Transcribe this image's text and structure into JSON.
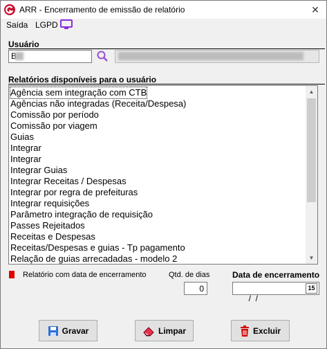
{
  "window": {
    "title": "ARR - Encerramento de emissão de relatório",
    "close_glyph": "✕"
  },
  "menu": {
    "items": [
      "Saída",
      "LGPD"
    ],
    "monitor_icon": "monitor-icon"
  },
  "user": {
    "label": "Usuário",
    "code_value": "B",
    "name_value": ""
  },
  "reports": {
    "label": "Relatórios disponíveis para o usuário",
    "items": [
      "Agência sem integração com CTB",
      "Agências não integradas (Receita/Despesa)",
      "Comissão por período",
      "Comissão por viagem",
      "Guias",
      "Integrar",
      "Integrar",
      "Integrar Guias",
      "Integrar Receitas / Despesas",
      "Integrar por regra de prefeituras",
      "Integrar requisições",
      "Parâmetro integração de requisição",
      "Passes Rejeitados",
      "Receitas e Despesas",
      "Receitas/Despesas e guias - Tp pagamento",
      "Relação de guias arrecadadas - modelo 2"
    ],
    "selected_index": 0,
    "scroll_up": "▲",
    "scroll_down": "▼"
  },
  "legend": {
    "text": "Relatório com data de encerramento",
    "color": "#e00000"
  },
  "qtd": {
    "label": "Qtd. de dias",
    "value": "0"
  },
  "date": {
    "label": "Data de encerramento",
    "value": " /  /",
    "calendar_label": "15"
  },
  "buttons": {
    "gravar": "Gravar",
    "limpar": "Limpar",
    "excluir": "Excluir"
  }
}
